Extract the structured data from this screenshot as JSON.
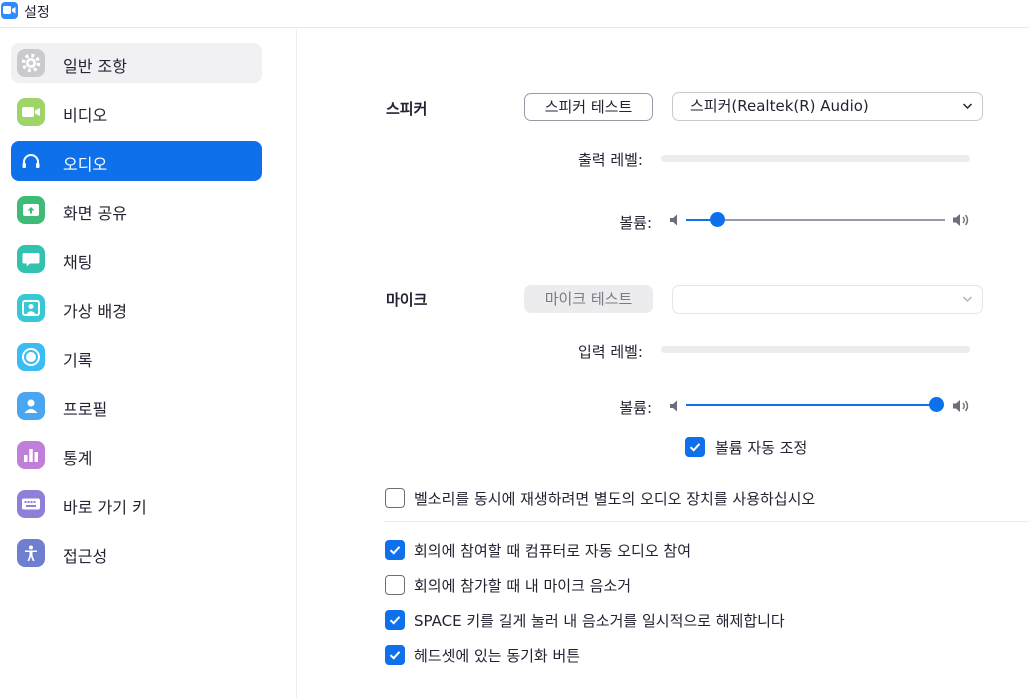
{
  "window": {
    "title": "설정"
  },
  "sidebar": {
    "items": [
      {
        "label": "일반 조항",
        "icon": "gear-icon",
        "color": "#c9c9cf",
        "state": "hovered"
      },
      {
        "label": "비디오",
        "icon": "video-camera-icon",
        "color": "#9fd46a",
        "state": "normal"
      },
      {
        "label": "오디오",
        "icon": "headphones-icon",
        "color": "#0e71eb",
        "state": "selected"
      },
      {
        "label": "화면 공유",
        "icon": "share-screen-icon",
        "color": "#3dbb77",
        "state": "normal"
      },
      {
        "label": "채팅",
        "icon": "chat-bubble-icon",
        "color": "#32c3b0",
        "state": "normal"
      },
      {
        "label": "가상 배경",
        "icon": "virtual-background-icon",
        "color": "#37c8d6",
        "state": "normal"
      },
      {
        "label": "기록",
        "icon": "record-icon",
        "color": "#3bbcf2",
        "state": "normal"
      },
      {
        "label": "프로필",
        "icon": "profile-icon",
        "color": "#4aa6f0",
        "state": "normal"
      },
      {
        "label": "통계",
        "icon": "statistics-icon",
        "color": "#c07fd9",
        "state": "normal"
      },
      {
        "label": "바로 가기 키",
        "icon": "keyboard-icon",
        "color": "#8e7fd9",
        "state": "normal"
      },
      {
        "label": "접근성",
        "icon": "accessibility-icon",
        "color": "#6f7fd0",
        "state": "normal"
      }
    ]
  },
  "speaker": {
    "label": "스피커",
    "test_button": "스피커 테스트",
    "device": "스피커(Realtek(R) Audio)",
    "output_level_label": "출력 레벨:",
    "volume_label": "볼륨:",
    "volume": 0.12
  },
  "mic": {
    "label": "마이크",
    "test_button": "마이크 테스트",
    "device": "",
    "input_level_label": "입력 레벨:",
    "volume_label": "볼륨:",
    "volume": 1.0,
    "auto_adjust": {
      "label": "볼륨 자동 조정",
      "checked": true
    }
  },
  "options": [
    {
      "label": "벨소리를 동시에 재생하려면 별도의 오디오 장치를 사용하십시오",
      "checked": false
    },
    {
      "label": "회의에 참여할 때 컴퓨터로 자동 오디오 참여",
      "checked": true
    },
    {
      "label": "회의에 참가할 때 내 마이크 음소거",
      "checked": false
    },
    {
      "label": "SPACE 키를 길게 눌러 내 음소거를 일시적으로 해제합니다",
      "checked": true
    },
    {
      "label": "헤드셋에 있는 동기화 버튼",
      "checked": true
    }
  ],
  "colors": {
    "accent": "#0e71eb"
  }
}
